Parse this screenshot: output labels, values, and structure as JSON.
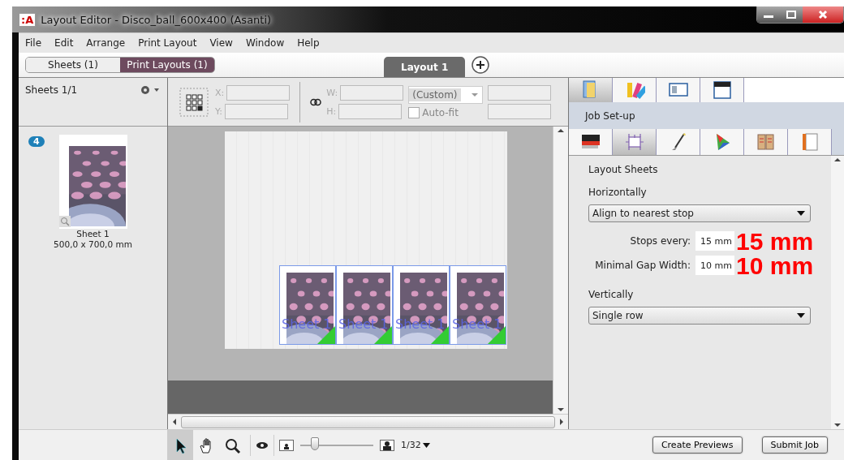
{
  "window": {
    "title": "Layout Editor - Disco_ball_600x400 (Asanti)",
    "app_badge": ":A"
  },
  "menu": [
    "File",
    "Edit",
    "Arrange",
    "Print Layout",
    "View",
    "Window",
    "Help"
  ],
  "view_switch": [
    {
      "label": "Sheets (1)",
      "selected": false
    },
    {
      "label": "Print Layouts (1)",
      "selected": true
    }
  ],
  "layout_tabs": [
    {
      "label": "Layout 1",
      "selected": true
    }
  ],
  "sidebar": {
    "header": "Sheets 1/1",
    "sheets": [
      {
        "badge": "4",
        "name": "Sheet 1",
        "size": "500,0 x 700,0 mm"
      }
    ]
  },
  "toolbar": {
    "x_label": "X:",
    "y_label": "Y:",
    "w_label": "W:",
    "h_label": "H:",
    "preset": "(Custom)",
    "autofit": {
      "label": "Auto-fit",
      "checked": false
    }
  },
  "canvas": {
    "tiles": [
      {
        "label": "Sheet 1"
      },
      {
        "label": "Sheet 1"
      },
      {
        "label": "Sheet 1"
      },
      {
        "label": "Sheet 1"
      }
    ]
  },
  "panel": {
    "top_tabs": [
      {
        "kind": "folder",
        "selected": true
      },
      {
        "kind": "swatches",
        "selected": false
      },
      {
        "kind": "card",
        "selected": false
      },
      {
        "kind": "media",
        "selected": false
      }
    ],
    "section": "Job Set-up",
    "sub_tabs": [
      {
        "kind": "printer",
        "selected": false
      },
      {
        "kind": "marks",
        "selected": true
      },
      {
        "kind": "brush",
        "selected": false
      },
      {
        "kind": "gamut",
        "selected": false
      },
      {
        "kind": "clipboard",
        "selected": false
      },
      {
        "kind": "document",
        "selected": false
      }
    ],
    "heading": "Layout Sheets",
    "horizontal_label": "Horizontally",
    "horizontal_value": "Align to nearest stop",
    "fields": [
      {
        "label": "Stops every:",
        "value": "15 mm",
        "annotation": "15 mm"
      },
      {
        "label": "Minimal Gap Width:",
        "value": "10 mm",
        "annotation": "10 mm"
      }
    ],
    "vertical_label": "Vertically",
    "vertical_value": "Single row"
  },
  "tools": [
    {
      "kind": "pointer",
      "selected": true
    },
    {
      "kind": "hand",
      "selected": false
    },
    {
      "kind": "zoom",
      "selected": false
    }
  ],
  "zoom": {
    "level": 0.2,
    "reading": "1/32"
  },
  "buttons": [
    "Create Previews",
    "Submit Job"
  ]
}
